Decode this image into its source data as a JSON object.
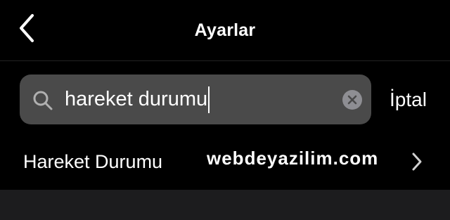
{
  "nav": {
    "title": "Ayarlar",
    "back_icon": "chevron-left-icon"
  },
  "search": {
    "value": "hareket durumu",
    "icon": "search-icon",
    "clear_icon": "clear-icon",
    "cancel_label": "İptal"
  },
  "results": [
    {
      "label": "Hareket Durumu",
      "icon": "chevron-right-icon"
    }
  ],
  "watermark": "webdeyazilim.com",
  "colors": {
    "background": "#000000",
    "search_field": "#4a4a4a",
    "clear_button": "#8e8e93",
    "footer": "#1c1c1e",
    "text": "#ffffff"
  }
}
